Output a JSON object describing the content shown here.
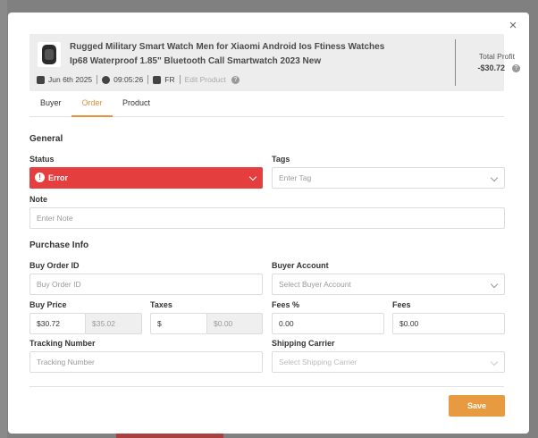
{
  "product": {
    "title_line1": "Rugged Military Smart Watch Men for Xiaomi Android Ios Ftiness Watches",
    "title_line2": "Ip68 Waterproof 1.85\" Bluetooth Call Smartwatch 2023 New",
    "date": "Jun 6th 2025",
    "time": "09:05:26",
    "country": "FR",
    "edit_link": "Edit Product",
    "profit_label": "Total Profit",
    "profit_value": "-$30.72"
  },
  "tabs": [
    {
      "label": "Buyer"
    },
    {
      "label": "Order",
      "active": true
    },
    {
      "label": "Product"
    }
  ],
  "general": {
    "title": "General",
    "status_label": "Status",
    "status_value": "Error",
    "tags_label": "Tags",
    "tags_placeholder": "Enter Tag",
    "note_label": "Note",
    "note_placeholder": "Enter Note"
  },
  "purchase": {
    "title": "Purchase Info",
    "buy_order_id_label": "Buy Order ID",
    "buy_order_id_placeholder": "Buy Order ID",
    "buyer_account_label": "Buyer Account",
    "buyer_account_placeholder": "Select Buyer Account",
    "buy_price_label": "Buy Price",
    "buy_price_value": "$30.72",
    "buy_price_converted": "$35.02",
    "taxes_label": "Taxes",
    "taxes_currency": "$",
    "taxes_value": "$0.00",
    "fees_pct_label": "Fees %",
    "fees_pct_value": "0.00",
    "fees_label": "Fees",
    "fees_value": "$0.00",
    "tracking_label": "Tracking Number",
    "tracking_placeholder": "Tracking Number",
    "carrier_label": "Shipping Carrier",
    "carrier_placeholder": "Select Shipping Carrier"
  },
  "actions": {
    "save_label": "Save",
    "close_glyph": "×"
  },
  "colors": {
    "accent": "#e8913a",
    "error": "#e53e3e"
  }
}
